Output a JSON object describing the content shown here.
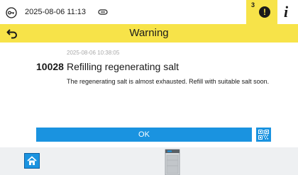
{
  "statusbar": {
    "datetime": "2025-08-06 11:13",
    "warning_count": "3",
    "warning_symbol": "!",
    "info_symbol": "i"
  },
  "header": {
    "title": "Warning"
  },
  "message": {
    "timestamp": "2025-08-06 10:38:05",
    "code": "10028",
    "title": "Refilling regenerating salt",
    "description": "The regenerating salt is almost exhausted. Refill with suitable salt soon."
  },
  "actions": {
    "ok_label": "OK"
  },
  "colors": {
    "accent_yellow": "#f7e349",
    "primary_blue": "#1a93e0",
    "bottom_bar": "#eef0f2"
  },
  "icons": {
    "status": [
      "key-icon",
      "link-icon",
      "warning-icon",
      "info-icon"
    ],
    "header": [
      "back-arrow-icon"
    ],
    "actions": [
      "qr-code-icon"
    ],
    "bottom": [
      "home-icon",
      "dishwasher-icon"
    ]
  }
}
